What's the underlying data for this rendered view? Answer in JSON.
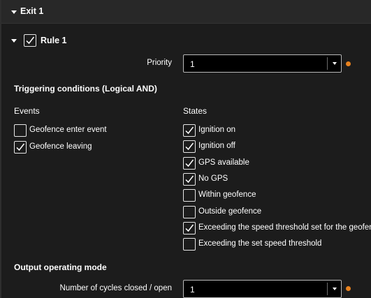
{
  "exit": {
    "title": "Exit 1"
  },
  "rule": {
    "title": "Rule 1",
    "checked": true
  },
  "priority": {
    "label": "Priority",
    "value": "1",
    "status_color": "#e8821e"
  },
  "triggering": {
    "title": "Triggering conditions (Logical AND)",
    "events_header": "Events",
    "states_header": "States",
    "events": [
      {
        "label": "Geofence enter event",
        "checked": false
      },
      {
        "label": "Geofence leaving",
        "checked": true
      }
    ],
    "states": [
      {
        "label": "Ignition on",
        "checked": true
      },
      {
        "label": "Ignition off",
        "checked": true
      },
      {
        "label": "GPS available",
        "checked": true
      },
      {
        "label": "No GPS",
        "checked": true
      },
      {
        "label": "Within geofence",
        "checked": false
      },
      {
        "label": "Outside geofence",
        "checked": false
      },
      {
        "label": "Exceeding the speed threshold set for the geofence",
        "checked": true
      },
      {
        "label": "Exceeding the set speed threshold",
        "checked": false
      }
    ]
  },
  "output": {
    "title": "Output operating mode",
    "cycles_label": "Number of cycles closed / open",
    "cycles_value": "1",
    "status_color": "#e8821e"
  },
  "icons": {
    "expand": "caret-down-icon",
    "check": "checkmark-icon",
    "dropdown": "chevron-down-icon",
    "status": "status-dot-icon"
  }
}
